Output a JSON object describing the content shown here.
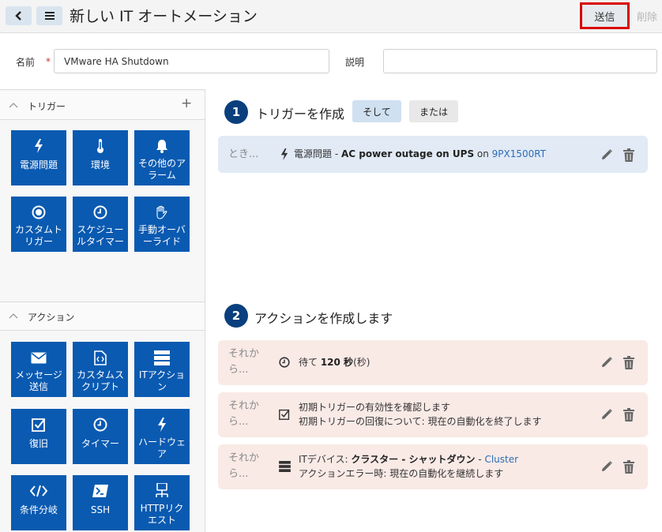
{
  "header": {
    "back_icon": "chevron-left-icon",
    "menu_icon": "hamburger-menu-icon",
    "title": "新しい IT オートメーション",
    "send_label": "送信",
    "delete_label": "削除"
  },
  "form": {
    "name_label": "名前",
    "required_mark": "*",
    "name_value": "VMware HA Shutdown",
    "description_label": "説明",
    "description_value": ""
  },
  "triggers_panel": {
    "title": "トリガー",
    "add_icon": "plus-icon",
    "tiles": [
      {
        "icon": "lightning-icon",
        "label": "電源問題"
      },
      {
        "icon": "thermometer-icon",
        "label": "環境"
      },
      {
        "icon": "bell-icon",
        "label": "その他のアラーム"
      },
      {
        "icon": "record-icon",
        "label": "カスタムトリガー"
      },
      {
        "icon": "clock-icon",
        "label": "スケジュールタイマー"
      },
      {
        "icon": "hand-icon",
        "label": "手動オーバーライド"
      }
    ]
  },
  "actions_panel": {
    "title": "アクション",
    "tiles": [
      {
        "icon": "envelope-icon",
        "label": "メッセージ送信"
      },
      {
        "icon": "script-file-icon",
        "label": "カスタムスクリプト"
      },
      {
        "icon": "server-icon",
        "label": "ITアクション"
      },
      {
        "icon": "checkbox-icon",
        "label": "復旧"
      },
      {
        "icon": "clock-icon",
        "label": "タイマー"
      },
      {
        "icon": "lightning-icon",
        "label": "ハードウェア"
      },
      {
        "icon": "code-icon",
        "label": "条件分岐"
      },
      {
        "icon": "terminal-icon",
        "label": "SSH"
      },
      {
        "icon": "network-icon",
        "label": "HTTPリクエスト"
      }
    ]
  },
  "step1": {
    "number": "1",
    "title": "トリガーを作成",
    "and_label": "そして",
    "or_label": "または",
    "card": {
      "prefix": "とき...",
      "icon": "lightning-icon",
      "category": "電源問題",
      "separator": " - ",
      "event": "AC power outage on UPS",
      "on_word": " on ",
      "device": "9PX1500RT"
    }
  },
  "step2": {
    "number": "2",
    "title": "アクションを作成します",
    "prefix_line1": "それか",
    "prefix_line2": "ら...",
    "prefix_single": "それから...",
    "cards": [
      {
        "icon": "clock-icon",
        "text_pre": "待て ",
        "text_bold": "120 秒",
        "text_post": "(秒)"
      },
      {
        "icon": "checkbox-icon",
        "line1": "初期トリガーの有効性を確認します",
        "line2": "初期トリガーの回復について: 現在の自動化を終了します"
      },
      {
        "icon": "server-icon",
        "line1_pre": "ITデバイス: ",
        "line1_bold": "クラスター - シャットダウン",
        "line1_sep": " - ",
        "line1_link": "Cluster",
        "line2": "アクションエラー時: 現在の自動化を継続します"
      }
    ]
  },
  "colors": {
    "tile_blue": "#0a5ab1",
    "step_circle": "#0a3f7d",
    "trigger_card": "#e1eaf5",
    "action_card": "#f9eae6",
    "highlight_border": "#d80000",
    "link": "#2d6db5"
  }
}
